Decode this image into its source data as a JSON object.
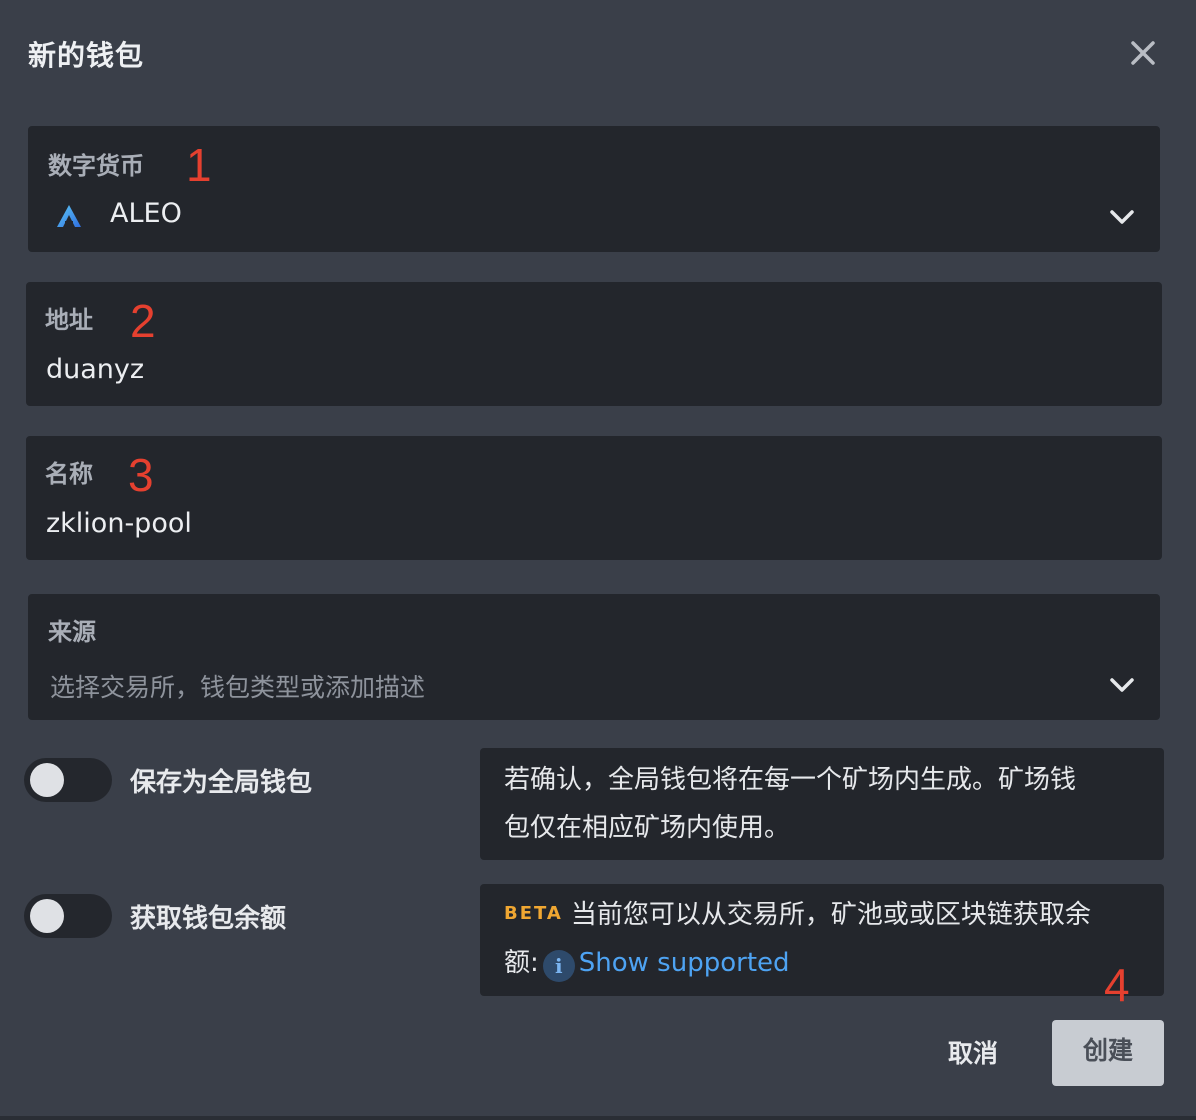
{
  "dialog": {
    "title": "新的钱包",
    "close_icon": "close-icon"
  },
  "currency": {
    "label": "数字货币",
    "marker": "1",
    "value": "ALEO",
    "icon": "aleo-logo",
    "dropdown_icon": "chevron-down-icon"
  },
  "address": {
    "label": "地址",
    "marker": "2",
    "value": "duanyz"
  },
  "name": {
    "label": "名称",
    "marker": "3",
    "value": "zklion-pool"
  },
  "source": {
    "label": "来源",
    "placeholder": "选择交易所，钱包类型或添加描述",
    "dropdown_icon": "chevron-down-icon"
  },
  "global_wallet": {
    "label": "保存为全局钱包",
    "enabled": false,
    "info_line1": "若确认，全局钱包将在每一个矿场内生成。矿场钱",
    "info_line2": "包仅在相应矿场内使用。"
  },
  "balance": {
    "label": "获取钱包余额",
    "enabled": false,
    "badge": "BETA",
    "info_line1": "当前您可以从交易所，矿池或或区块链获取余",
    "info_line2_prefix": "额:",
    "info_icon_glyph": "i",
    "link": "Show supported",
    "marker": "4"
  },
  "actions": {
    "cancel": "取消",
    "create": "创建"
  },
  "colors": {
    "background": "#3a3f49",
    "field": "#23262c",
    "marker": "#e5402f",
    "beta": "#f0a732",
    "link": "#4ea3f2"
  }
}
